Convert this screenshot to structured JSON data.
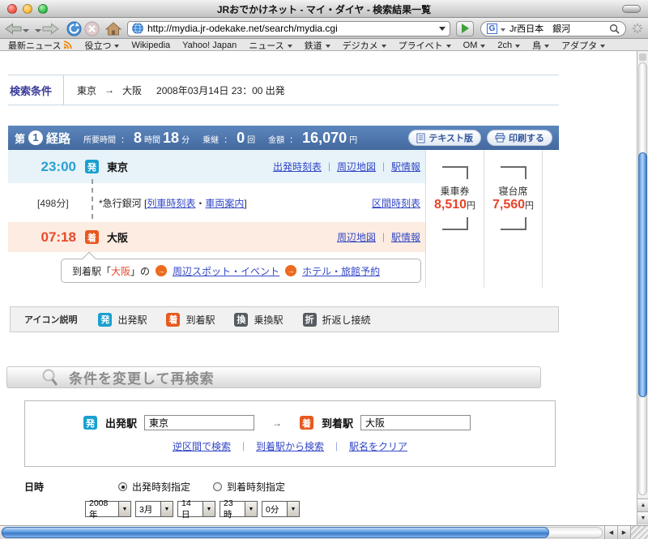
{
  "ui": {
    "menu_arrow": "▼",
    "select_arrow": "▼",
    "scroll_up": "▲",
    "scroll_down": "▼",
    "scroll_left": "◀",
    "scroll_right": "▶",
    "sep": "｜",
    "colon": "：",
    "circle_arrow": "→"
  },
  "window": {
    "title": "JRおでかけネット - マイ・ダイヤ - 検索結果一覧"
  },
  "toolbar": {
    "url": "http://mydia.jr-odekake.net/search/mydia.cgi",
    "search_engine": "G",
    "search_value": "Jr西日本　銀河"
  },
  "bookmarks": [
    {
      "label": "最新ニュース"
    },
    {
      "label": "役立つ",
      "menu": true
    },
    {
      "label": "Wikipedia"
    },
    {
      "label": "Yahoo! Japan"
    },
    {
      "label": "ニュース",
      "menu": true
    },
    {
      "label": "鉄道",
      "menu": true
    },
    {
      "label": "デジカメ",
      "menu": true
    },
    {
      "label": "プライベト",
      "menu": true
    },
    {
      "label": "OM",
      "menu": true
    },
    {
      "label": "2ch",
      "menu": true
    },
    {
      "label": "鳥",
      "menu": true
    },
    {
      "label": "アダプタ",
      "menu": true
    }
  ],
  "search_conditions": {
    "label": "検索条件",
    "from": "東京",
    "arrow": "→",
    "to": "大阪",
    "datetime": "2008年03月14日 23：00 出発"
  },
  "route_header": {
    "prefix": "第",
    "number": "1",
    "suffix": "経路",
    "duration_label": "所要時間",
    "hours": "8",
    "hours_unit": "時間",
    "minutes": "18",
    "minutes_unit": "分",
    "transfers_label": "乗継",
    "transfers": "0",
    "transfers_unit": "回",
    "amount_label": "金額",
    "amount": "16,070",
    "amount_unit": "円",
    "text_button": "テキスト版",
    "print_button": "印刷する"
  },
  "route": {
    "departure": {
      "time": "23:00",
      "badge": "発",
      "station": "東京",
      "links": [
        "出発時刻表",
        "周辺地図",
        "駅情報"
      ]
    },
    "segment": {
      "duration": "[498分]",
      "train_name": "*急行銀河",
      "bracket_open": "[",
      "links": [
        "列車時刻表",
        "車両案内"
      ],
      "link_sep": "・",
      "bracket_close": "]",
      "right_link": "区間時刻表"
    },
    "arrival": {
      "time": "07:18",
      "badge": "着",
      "station": "大阪",
      "links": [
        "周辺地図",
        "駅情報"
      ]
    }
  },
  "fares": [
    {
      "label": "乗車券",
      "price": "8,510",
      "unit": "円"
    },
    {
      "label": "寝台席",
      "price": "7,560",
      "unit": "円"
    }
  ],
  "arrival_bubble": {
    "prefix": "到着駅「",
    "station": "大阪",
    "suffix": "」の",
    "links": [
      "周辺スポット・イベント",
      "ホテル・旅館予約"
    ]
  },
  "legend": {
    "label": "アイコン説明",
    "items": [
      {
        "badge": "発",
        "label": "出発駅"
      },
      {
        "badge": "着",
        "label": "到着駅"
      },
      {
        "badge": "換",
        "label": "乗換駅"
      },
      {
        "badge": "折",
        "label": "折返し接続"
      }
    ]
  },
  "research": {
    "title": "条件を変更して再検索",
    "from_badge": "発",
    "from_label": "出発駅",
    "from_value": "東京",
    "arrow": "→",
    "to_badge": "着",
    "to_label": "到着駅",
    "to_value": "大阪",
    "links": [
      "逆区間で検索",
      "到着駅から検索",
      "駅名をクリア"
    ]
  },
  "datetime_form": {
    "label": "日時",
    "radio_depart": "出発時刻指定",
    "radio_arrive": "到着時刻指定",
    "selected": "depart",
    "selects": [
      "2008年",
      "3月",
      "14日",
      "23時",
      "0分"
    ]
  },
  "colors": {
    "header_blue": "#44699f",
    "depart_badge": "#1a9fd0",
    "arrive_badge": "#e7591f",
    "neutral_badge": "#565a61",
    "depart_time": "#2aa0cf",
    "arrive_time": "#e8492b",
    "price_red": "#e8432a",
    "link_blue": "#3347c6",
    "depart_row_bg": "#e7f3f9",
    "arrive_row_bg": "#fdece1"
  }
}
